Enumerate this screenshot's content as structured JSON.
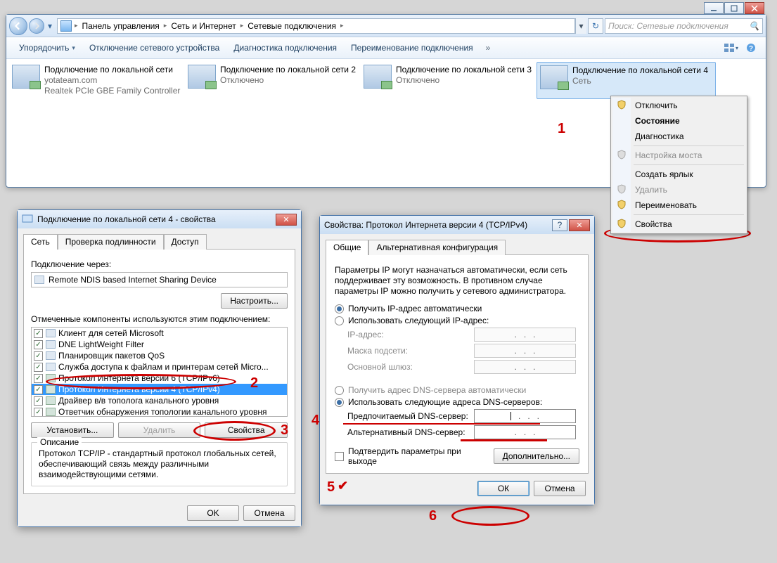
{
  "explorer": {
    "breadcrumb": [
      "Панель управления",
      "Сеть и Интернет",
      "Сетевые подключения"
    ],
    "search_placeholder": "Поиск: Сетевые подключения",
    "toolbar": {
      "organize": "Упорядочить",
      "disable": "Отключение сетевого устройства",
      "diagnose": "Диагностика подключения",
      "rename": "Переименование подключения"
    },
    "connections": [
      {
        "title": "Подключение по локальной сети",
        "line2": "yotateam.com",
        "line3": "Realtek PCIe GBE Family Controller"
      },
      {
        "title": "Подключение по локальной сети 2",
        "line2": "Отключено",
        "line3": ""
      },
      {
        "title": "Подключение по локальной сети 3",
        "line2": "Отключено",
        "line3": ""
      },
      {
        "title": "Подключение по локальной сети 4",
        "line2": "Сеть",
        "line3": ""
      }
    ]
  },
  "ctx": {
    "items": [
      "Отключить",
      "Состояние",
      "Диагностика",
      "Настройка моста",
      "Создать ярлык",
      "Удалить",
      "Переименовать",
      "Свойства"
    ]
  },
  "dlg_props": {
    "title": "Подключение по локальной сети 4 - свойства",
    "tabs": [
      "Сеть",
      "Проверка подлинности",
      "Доступ"
    ],
    "connect_via_label": "Подключение через:",
    "adapter": "Remote NDIS based Internet Sharing Device",
    "configure": "Настроить...",
    "components_label": "Отмеченные компоненты используются этим подключением:",
    "components": [
      "Клиент для сетей Microsoft",
      "DNE LightWeight Filter",
      "Планировщик пакетов QoS",
      "Служба доступа к файлам и принтерам сетей Micro...",
      "Протокол Интернета версии 6 (TCP/IPv6)",
      "Протокол Интернета версии 4 (TCP/IPv4)",
      "Драйвер в/в тополога канального уровня",
      "Ответчик обнаружения топологии канального уровня"
    ],
    "install": "Установить...",
    "remove": "Удалить",
    "properties": "Свойства",
    "desc_title": "Описание",
    "desc_text": "Протокол TCP/IP - стандартный протокол глобальных сетей, обеспечивающий связь между различными взаимодействующими сетями.",
    "ok": "OK",
    "cancel": "Отмена"
  },
  "dlg_ip": {
    "title": "Свойства: Протокол Интернета версии 4 (TCP/IPv4)",
    "tabs": [
      "Общие",
      "Альтернативная конфигурация"
    ],
    "intro": "Параметры IP могут назначаться автоматически, если сеть поддерживает эту возможность. В противном случае параметры IP можно получить у сетевого администратора.",
    "auto_ip": "Получить IP-адрес автоматически",
    "manual_ip": "Использовать следующий IP-адрес:",
    "ip_addr": "IP-адрес:",
    "mask": "Маска подсети:",
    "gateway": "Основной шлюз:",
    "auto_dns": "Получить адрес DNS-сервера автоматически",
    "manual_dns": "Использовать следующие адреса DNS-серверов:",
    "pref_dns": "Предпочитаемый DNS-сервер:",
    "alt_dns": "Альтернативный DNS-сервер:",
    "validate": "Подтвердить параметры при выходе",
    "advanced": "Дополнительно...",
    "ok": "ОК",
    "cancel": "Отмена"
  },
  "annot": {
    "a1": "1",
    "a2": "2",
    "a3": "3",
    "a4": "4",
    "a5": "5",
    "a6": "6"
  }
}
